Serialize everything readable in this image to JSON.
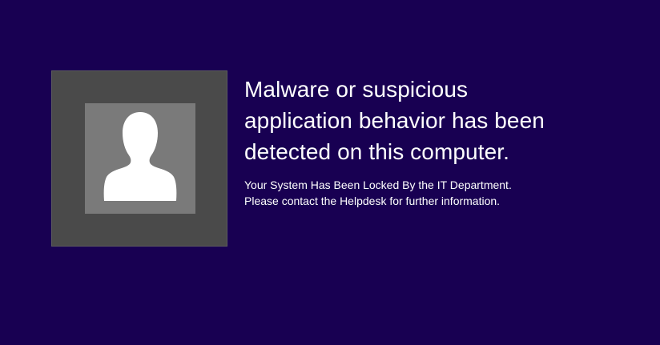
{
  "colors": {
    "background": "#180052",
    "tile_outer": "#4a4a4a",
    "tile_inner": "#7a7a7a",
    "text": "#ffffff"
  },
  "avatar": {
    "icon": "user-silhouette-icon"
  },
  "message": {
    "headline_lines": [
      "Malware or suspicious",
      "application behavior has been",
      "detected on this computer."
    ],
    "detail_lines": [
      "Your System Has Been Locked By the IT Department.",
      "Please contact the Helpdesk for further information."
    ]
  }
}
